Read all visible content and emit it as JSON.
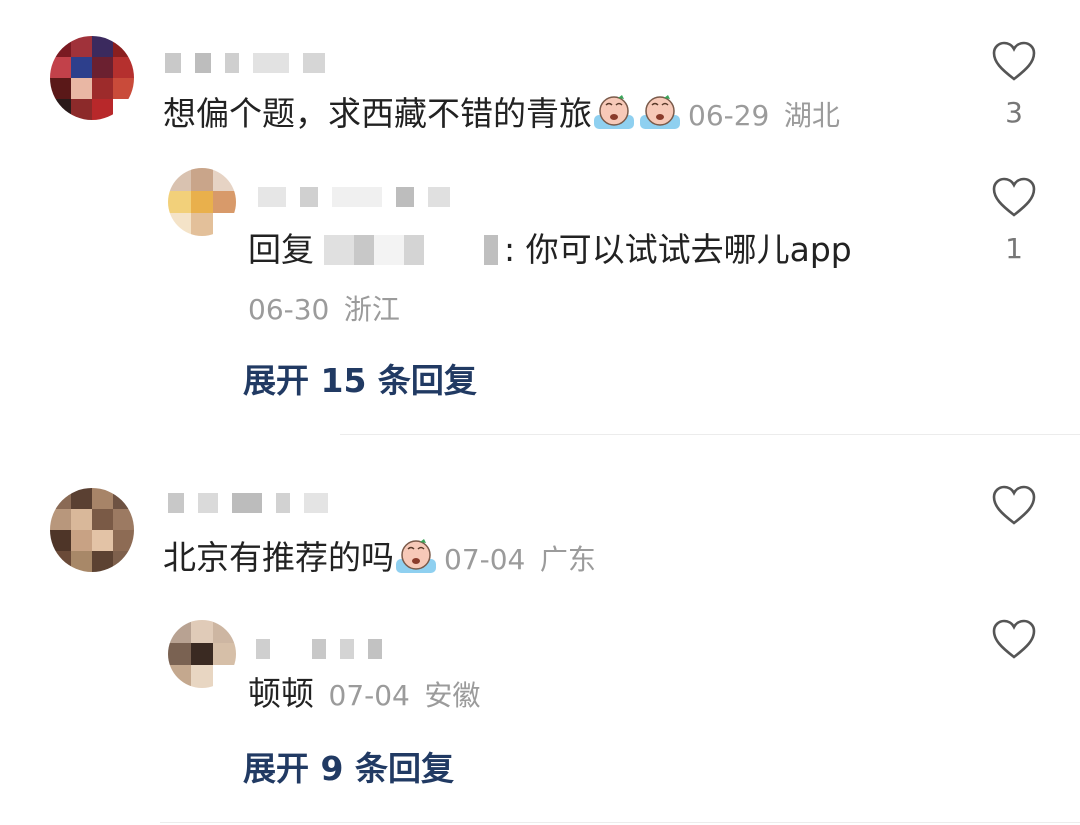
{
  "colors": {
    "expand_link": "#213a63",
    "meta_text": "#9b9b9b",
    "body_text": "#222222",
    "heart_outline": "#555555"
  },
  "comments": [
    {
      "text": "想偏个题，求西藏不错的青旅",
      "emojis": [
        "crying-emoji",
        "crying-emoji"
      ],
      "date": "06-29",
      "location": "湖北",
      "likes": "3",
      "replies": [
        {
          "prefix": "回复",
          "text": ": 你可以试试去哪儿app",
          "date": "06-30",
          "location": "浙江",
          "likes": "1"
        }
      ],
      "expand_label": "展开 15 条回复"
    },
    {
      "text": "北京有推荐的吗",
      "emojis": [
        "crying-emoji"
      ],
      "date": "07-04",
      "location": "广东",
      "likes": "",
      "replies": [
        {
          "text": "顿顿",
          "date": "07-04",
          "location": "安徽",
          "likes": ""
        }
      ],
      "expand_label": "展开 9 条回复"
    }
  ]
}
